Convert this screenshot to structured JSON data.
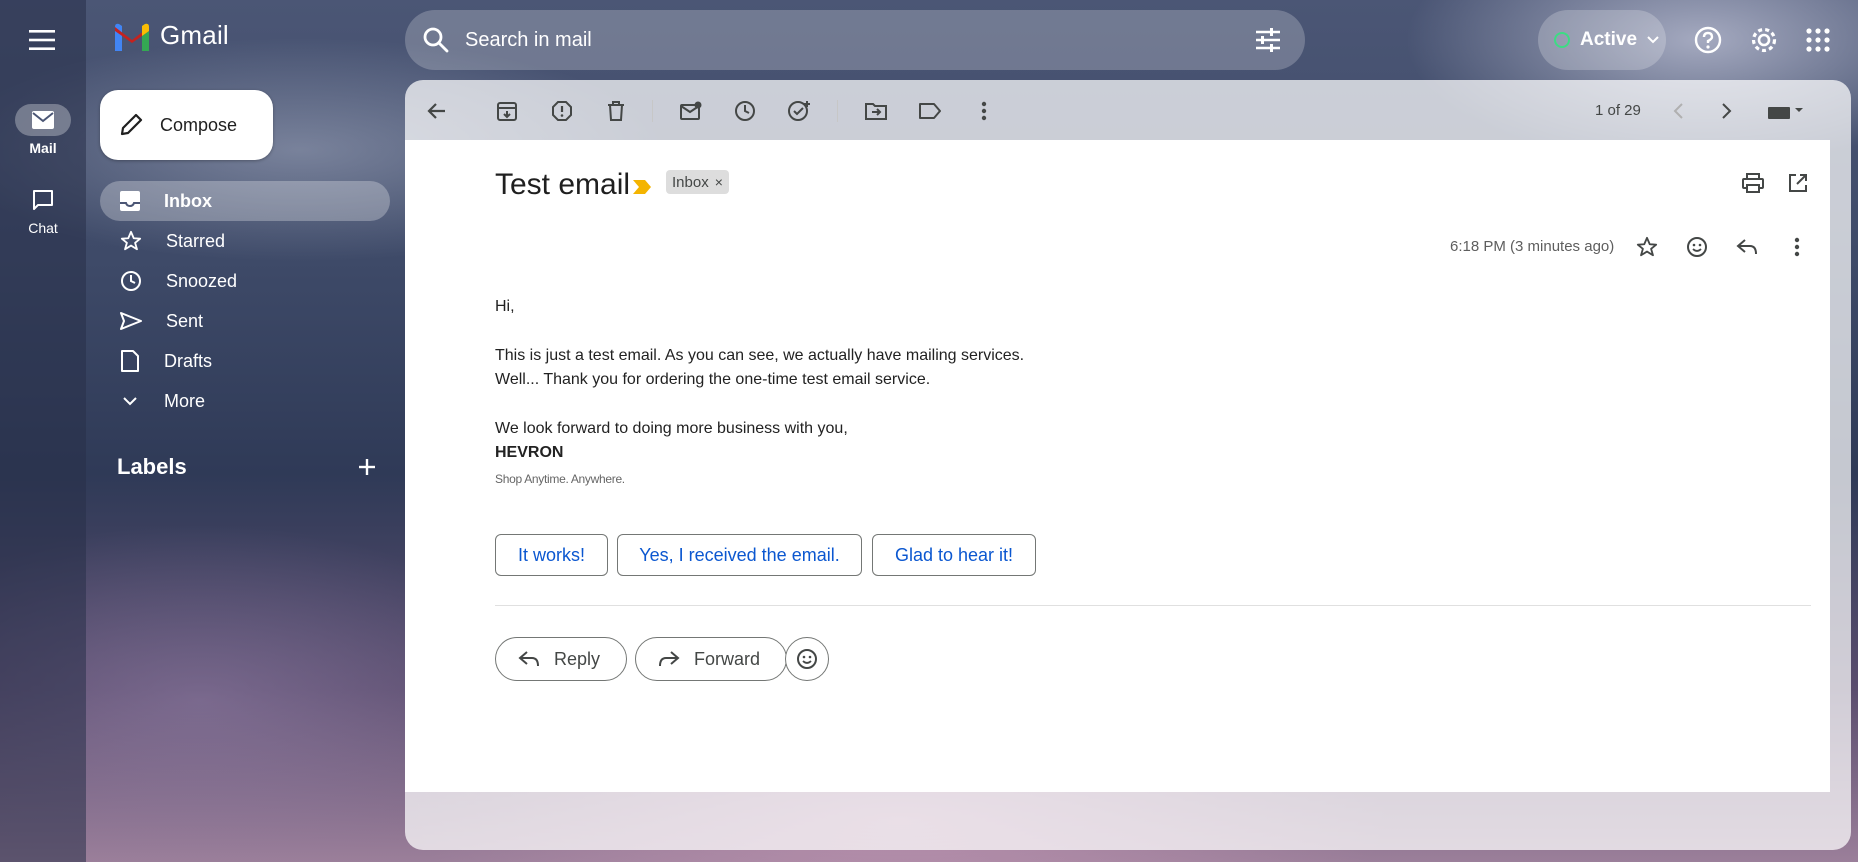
{
  "app": {
    "name": "Gmail"
  },
  "rail": {
    "items": [
      {
        "label": "Mail",
        "icon": "mail-icon",
        "active": true
      },
      {
        "label": "Chat",
        "icon": "chat-icon",
        "active": false
      }
    ]
  },
  "search": {
    "placeholder": "Search in mail"
  },
  "status": {
    "label": "Active"
  },
  "compose": {
    "label": "Compose"
  },
  "nav": {
    "items": [
      {
        "label": "Inbox",
        "icon": "inbox-icon",
        "active": true
      },
      {
        "label": "Starred",
        "icon": "star-icon"
      },
      {
        "label": "Snoozed",
        "icon": "clock-icon"
      },
      {
        "label": "Sent",
        "icon": "send-icon"
      },
      {
        "label": "Drafts",
        "icon": "draft-icon"
      },
      {
        "label": "More",
        "icon": "chevron-down-icon"
      }
    ],
    "labels_heading": "Labels"
  },
  "toolbar": {
    "pager": "1 of 29"
  },
  "email": {
    "subject": "Test email",
    "tag": "Inbox",
    "timestamp": "6:18 PM (3 minutes ago)",
    "body": {
      "greeting": "Hi,",
      "line1": "This is just a test email. As you can see, we actually have mailing services.",
      "line2": "Well... Thank you for ordering the one-time test email service.",
      "line3": "We look forward to doing more business with you,",
      "signature_name": "HEVRON",
      "signature_tagline": "Shop Anytime. Anywhere."
    },
    "smart_replies": [
      "It works!",
      "Yes, I received the email.",
      "Glad to hear it!"
    ],
    "actions": {
      "reply": "Reply",
      "forward": "Forward"
    }
  },
  "colors": {
    "accent": "#0b57d0",
    "status_green": "#3ddc84",
    "importance": "#f4b400"
  }
}
